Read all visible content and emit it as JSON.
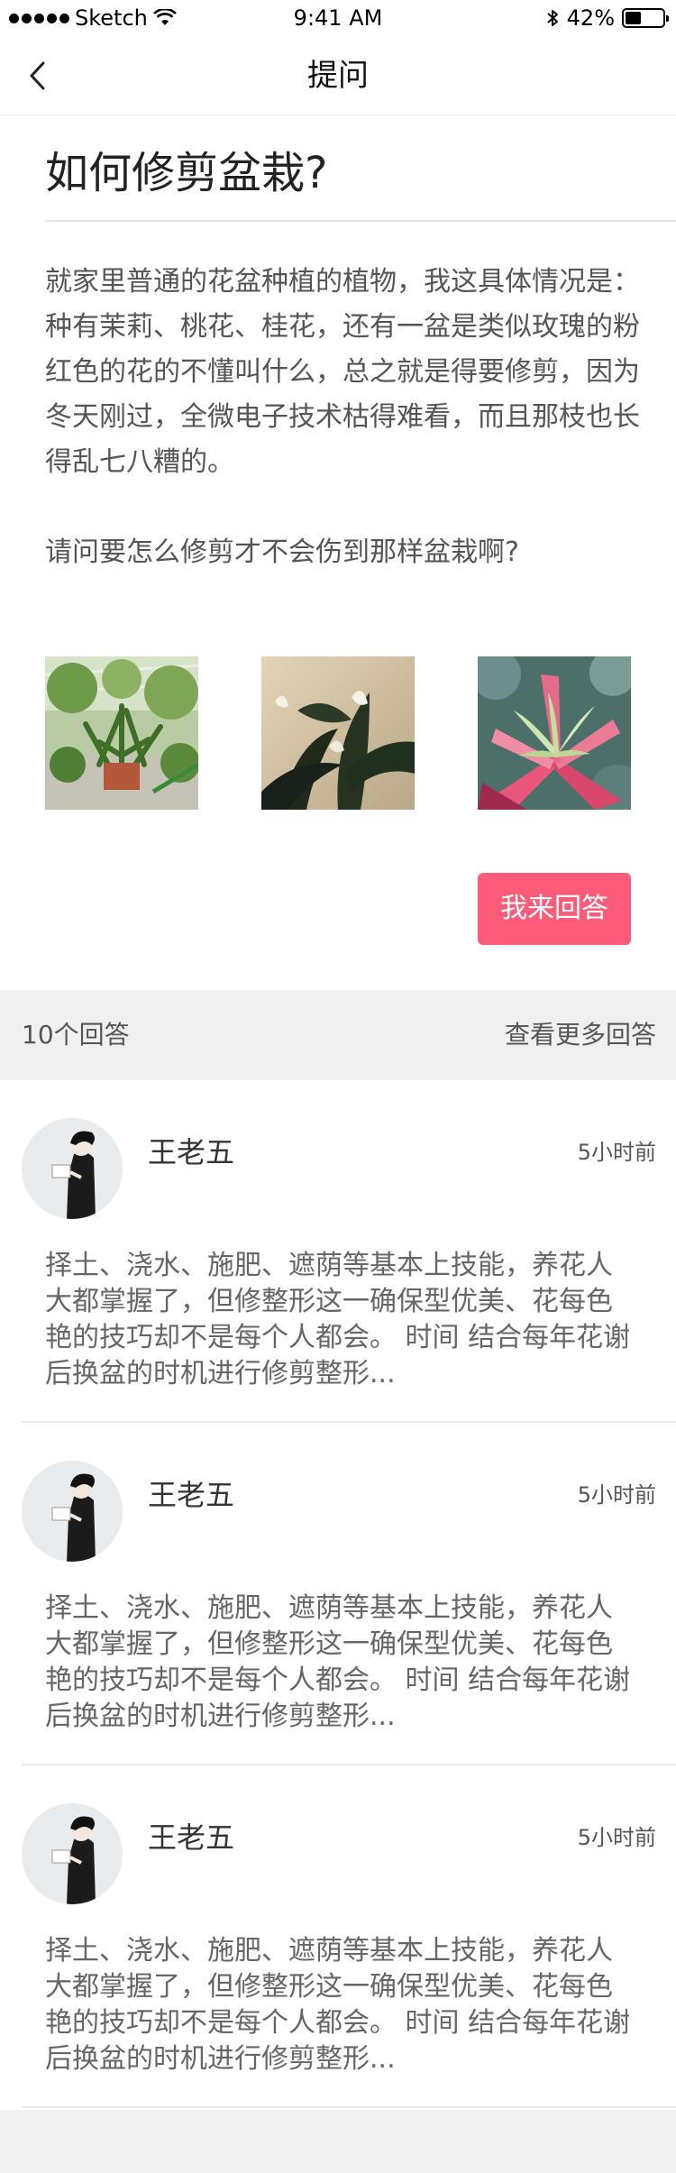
{
  "status_bar": {
    "carrier": "Sketch",
    "time": "9:41 AM",
    "battery": "42%",
    "battery_level": 0.42
  },
  "nav": {
    "title": "提问",
    "back_icon": "chevron-left-icon"
  },
  "question": {
    "title": "如何修剪盆栽?",
    "paragraphs": [
      "就家里普通的花盆种植的植物，我这具体情况是：种有茉莉、桃花、桂花，还有一盆是类似玫瑰的粉红色的花的不懂叫什么，总之就是得要修剪，因为冬天刚过，全微电子技术枯得难看，而且那枝也长得乱七八糟的。",
      "请问要怎么修剪才不会伤到那样盆栽啊?"
    ]
  },
  "answer_button": {
    "label": "我来回答",
    "color": "#fd5b7a"
  },
  "answers_header": {
    "count": "10个回答",
    "more": "查看更多回答"
  },
  "answers": [
    {
      "name": "王老五",
      "time": "5小时前",
      "content": "择土、浇水、施肥、遮荫等基本上技能，养花人大都掌握了，但修整形这一确保型优美、花每色艳的技巧却不是每个人都会。 时间 结合每年花谢后换盆的时机进行修剪整形..."
    },
    {
      "name": "王老五",
      "time": "5小时前",
      "content": "择土、浇水、施肥、遮荫等基本上技能，养花人大都掌握了，但修整形这一确保型优美、花每色艳的技巧却不是每个人都会。 时间 结合每年花谢后换盆的时机进行修剪整形..."
    },
    {
      "name": "王老五",
      "time": "5小时前",
      "content": "择土、浇水、施肥、遮荫等基本上技能，养花人大都掌握了，但修整形这一确保型优美、花每色艳的技巧却不是每个人都会。 时间 结合每年花谢后换盆的时机进行修剪整形..."
    }
  ]
}
